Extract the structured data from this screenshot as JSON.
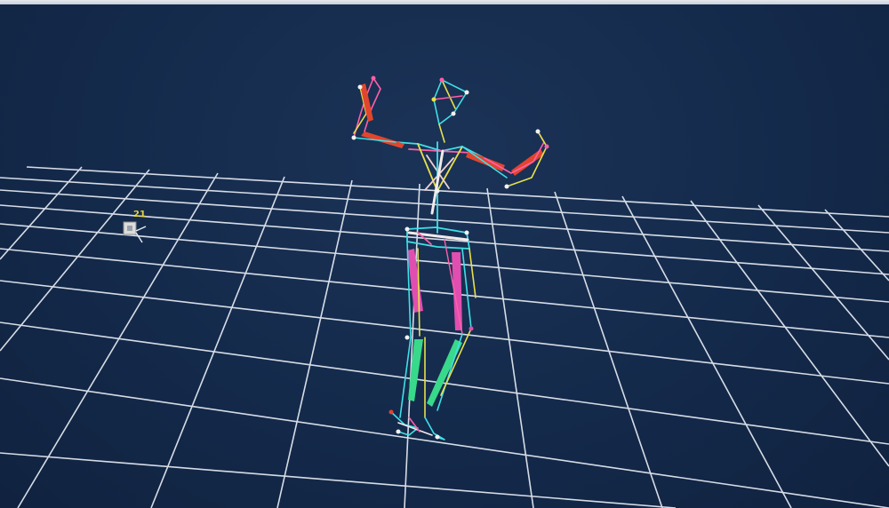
{
  "viewport": {
    "camera_label": "21",
    "colors": {
      "background": "#142a4b",
      "grid": "#e8ecf4",
      "camera_label": "#e8d23a",
      "upper_arm_segment": "#e2452e",
      "thigh_segment": "#e04fb0",
      "shin_segment": "#38d98a",
      "marker_link_cyan": "#3fe0e6",
      "marker_link_yellow": "#e8e04a",
      "marker_link_pink": "#ff5fa8"
    }
  }
}
